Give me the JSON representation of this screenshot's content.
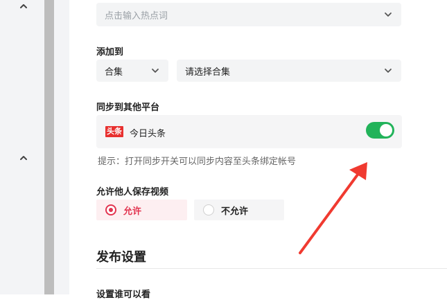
{
  "hotword": {
    "placeholder": "点击输入热点词"
  },
  "add_to": {
    "label": "添加到",
    "type_value": "合集",
    "collection_placeholder": "请选择合集"
  },
  "sync": {
    "label": "同步到其他平台",
    "platform_logo_text": "头条",
    "platform_name": "今日头条",
    "enabled": true,
    "hint": "提示：打开同步开关可以同步内容至头条绑定帐号"
  },
  "save_video": {
    "label": "允许他人保存视频",
    "options": [
      "允许",
      "不允许"
    ],
    "selected": "允许"
  },
  "publish_settings": {
    "title": "发布设置",
    "visibility_label": "设置谁可以看"
  },
  "colors": {
    "accent": "#e2334f",
    "toggle_on": "#22b35a",
    "annotation_arrow": "#f03a30"
  },
  "icons": [
    "chevron-up-icon",
    "chevron-down-icon",
    "toutiao-logo-icon"
  ]
}
